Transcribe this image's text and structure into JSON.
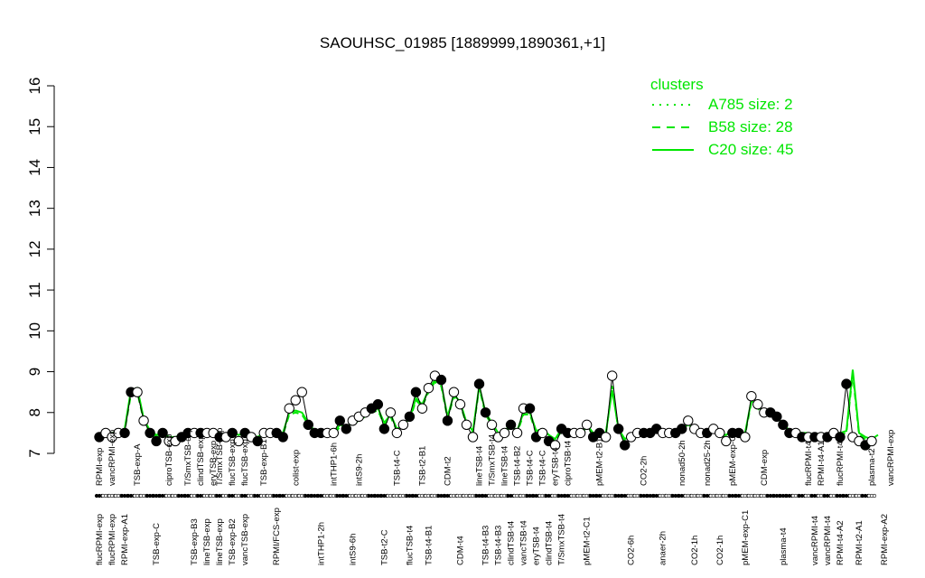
{
  "chart_data": {
    "type": "line",
    "title": "SAOUHSC_01985 [1889999,1890361,+1]",
    "ylim": [
      7,
      16
    ],
    "yticks": [
      7,
      8,
      9,
      10,
      11,
      12,
      13,
      14,
      15,
      16
    ],
    "legend": {
      "title": "clusters",
      "placement": "top-right",
      "entries": [
        {
          "label": "A785 size: 2",
          "style": "dotted"
        },
        {
          "label": "B58 size: 28",
          "style": "dashed"
        },
        {
          "label": "C20 size: 45",
          "style": "solid"
        }
      ]
    },
    "colors": {
      "cluster_line": "#00e600",
      "points_fill_a": "#000000",
      "points_fill_b": "#ffffff"
    },
    "tick_labels": [
      {
        "text": "flucRPMI-exp",
        "x": 1,
        "row": 0
      },
      {
        "text": "flucRPMI-exp",
        "x": 3,
        "row": 0
      },
      {
        "text": "RPMI-exp-A1",
        "x": 5,
        "row": 0
      },
      {
        "text": "TSB-exp-C",
        "x": 10,
        "row": 0
      },
      {
        "text": "TSB-exp-B3",
        "x": 16,
        "row": 0
      },
      {
        "text": "lineTSB-exp",
        "x": 18,
        "row": 0
      },
      {
        "text": "lineTSB-exp",
        "x": 20,
        "row": 0
      },
      {
        "text": "TSB-exp-B2",
        "x": 22,
        "row": 0
      },
      {
        "text": "vancTSB-exp",
        "x": 24,
        "row": 0
      },
      {
        "text": "RPMI/FCS-exp",
        "x": 29,
        "row": 0
      },
      {
        "text": "intTHP1-2h",
        "x": 36,
        "row": 0
      },
      {
        "text": "intS9-6h",
        "x": 41,
        "row": 0
      },
      {
        "text": "TSB-t2-C",
        "x": 46,
        "row": 0
      },
      {
        "text": "flucTSB-t4",
        "x": 50,
        "row": 0
      },
      {
        "text": "TSB-t4-B1",
        "x": 53,
        "row": 0
      },
      {
        "text": "CDM-t4",
        "x": 58,
        "row": 0
      },
      {
        "text": "TSB-t4-B3",
        "x": 62,
        "row": 0
      },
      {
        "text": "TSB-t4-B3",
        "x": 64,
        "row": 0
      },
      {
        "text": "clindTSB-t4",
        "x": 66,
        "row": 0
      },
      {
        "text": "vancTSB-t4",
        "x": 68,
        "row": 0
      },
      {
        "text": "eryTSB-t4",
        "x": 70,
        "row": 0
      },
      {
        "text": "clindTSB-t4",
        "x": 72,
        "row": 0
      },
      {
        "text": "T/SmxTSB-t4",
        "x": 74,
        "row": 0
      },
      {
        "text": "pMEM-t2-C1",
        "x": 78,
        "row": 0
      },
      {
        "text": "CO2-6h",
        "x": 85,
        "row": 0
      },
      {
        "text": "anaer-2h",
        "x": 90,
        "row": 0
      },
      {
        "text": "CO2-1h",
        "x": 95,
        "row": 0
      },
      {
        "text": "CO2-1h",
        "x": 99,
        "row": 0
      },
      {
        "text": "pMEM-exp-C1",
        "x": 103,
        "row": 0
      },
      {
        "text": "plasma-t4",
        "x": 109,
        "row": 0
      },
      {
        "text": "vancRPMI-t4",
        "x": 114,
        "row": 0
      },
      {
        "text": "vancRPMI-t4",
        "x": 116,
        "row": 0
      },
      {
        "text": "RPMI-t4-A2",
        "x": 118,
        "row": 0
      },
      {
        "text": "RPMI-t2-A1",
        "x": 121,
        "row": 0
      },
      {
        "text": "RPMI-exp-A2",
        "x": 125,
        "row": 0
      },
      {
        "text": "RPMI-exp",
        "x": 1,
        "row": 1
      },
      {
        "text": "vancRPMI-exp",
        "x": 3,
        "row": 1
      },
      {
        "text": "TSB-exp-A",
        "x": 7,
        "row": 1
      },
      {
        "text": "ciproTSB-exp",
        "x": 12,
        "row": 1
      },
      {
        "text": "T/SmxTSB-exp",
        "x": 15,
        "row": 1
      },
      {
        "text": "clindTSB-exp",
        "x": 17,
        "row": 1
      },
      {
        "text": "eryTSB-exp",
        "x": 19,
        "row": 1
      },
      {
        "text": "T/SmxTSB-exp",
        "x": 20,
        "row": 1
      },
      {
        "text": "flucTSB-exp",
        "x": 22,
        "row": 1
      },
      {
        "text": "flucTSB-exp",
        "x": 24,
        "row": 1
      },
      {
        "text": "TSB-exp-B1",
        "x": 27,
        "row": 1
      },
      {
        "text": "colist-exp",
        "x": 32,
        "row": 1
      },
      {
        "text": "intTHP1-6h",
        "x": 38,
        "row": 1
      },
      {
        "text": "intS9-2h",
        "x": 42,
        "row": 1
      },
      {
        "text": "TSB-t4-C",
        "x": 48,
        "row": 1
      },
      {
        "text": "TSB-t2-B1",
        "x": 52,
        "row": 1
      },
      {
        "text": "CDM-t2",
        "x": 56,
        "row": 1
      },
      {
        "text": "lineTSB-t4",
        "x": 61,
        "row": 1
      },
      {
        "text": "T/SmxTSB-t4",
        "x": 63,
        "row": 1
      },
      {
        "text": "lineTSB-t4",
        "x": 65,
        "row": 1
      },
      {
        "text": "TSB-t4-B2",
        "x": 67,
        "row": 1
      },
      {
        "text": "TSB-t4-C",
        "x": 69,
        "row": 1
      },
      {
        "text": "TSB-t4-C",
        "x": 71,
        "row": 1
      },
      {
        "text": "eryTSB-t4",
        "x": 73,
        "row": 1
      },
      {
        "text": "ciproTSB-t4",
        "x": 75,
        "row": 1
      },
      {
        "text": "pMEM-t2-B1",
        "x": 80,
        "row": 1
      },
      {
        "text": "CO2-2h",
        "x": 87,
        "row": 1
      },
      {
        "text": "nonad50-2h",
        "x": 93,
        "row": 1
      },
      {
        "text": "nonad25-2h",
        "x": 97,
        "row": 1
      },
      {
        "text": "pMEM-exp-C2",
        "x": 101,
        "row": 1
      },
      {
        "text": "CDM-exp",
        "x": 106,
        "row": 1
      },
      {
        "text": "flucRPMI-t4",
        "x": 113,
        "row": 1
      },
      {
        "text": "RPMI-t4-A1",
        "x": 115,
        "row": 1
      },
      {
        "text": "flucRPMI-t4",
        "x": 118,
        "row": 1
      },
      {
        "text": "plasma-t2",
        "x": 123,
        "row": 1
      },
      {
        "text": "vancRPMI-exp",
        "x": 126,
        "row": 1
      }
    ],
    "series": [
      {
        "x": 1,
        "y": 7.4,
        "filled": true
      },
      {
        "x": 2,
        "y": 7.5,
        "filled": false
      },
      {
        "x": 3,
        "y": 7.4,
        "filled": false
      },
      {
        "x": 4,
        "y": 7.5,
        "filled": false
      },
      {
        "x": 5,
        "y": 7.5,
        "filled": true
      },
      {
        "x": 6,
        "y": 8.5,
        "filled": true
      },
      {
        "x": 7,
        "y": 8.5,
        "filled": false
      },
      {
        "x": 8,
        "y": 7.8,
        "filled": false
      },
      {
        "x": 9,
        "y": 7.5,
        "filled": true
      },
      {
        "x": 10,
        "y": 7.3,
        "filled": true
      },
      {
        "x": 11,
        "y": 7.5,
        "filled": true
      },
      {
        "x": 12,
        "y": 7.3,
        "filled": false
      },
      {
        "x": 13,
        "y": 7.3,
        "filled": false
      },
      {
        "x": 14,
        "y": 7.4,
        "filled": true
      },
      {
        "x": 15,
        "y": 7.5,
        "filled": true
      },
      {
        "x": 16,
        "y": 7.5,
        "filled": false
      },
      {
        "x": 17,
        "y": 7.5,
        "filled": true
      },
      {
        "x": 18,
        "y": 7.5,
        "filled": false
      },
      {
        "x": 19,
        "y": 7.5,
        "filled": false
      },
      {
        "x": 20,
        "y": 7.4,
        "filled": true
      },
      {
        "x": 21,
        "y": 7.4,
        "filled": false
      },
      {
        "x": 22,
        "y": 7.5,
        "filled": true
      },
      {
        "x": 23,
        "y": 7.3,
        "filled": false
      },
      {
        "x": 24,
        "y": 7.5,
        "filled": true
      },
      {
        "x": 25,
        "y": 7.4,
        "filled": false
      },
      {
        "x": 26,
        "y": 7.3,
        "filled": true
      },
      {
        "x": 27,
        "y": 7.5,
        "filled": false
      },
      {
        "x": 28,
        "y": 7.5,
        "filled": false
      },
      {
        "x": 29,
        "y": 7.5,
        "filled": true
      },
      {
        "x": 30,
        "y": 7.4,
        "filled": true
      },
      {
        "x": 31,
        "y": 8.1,
        "filled": false
      },
      {
        "x": 32,
        "y": 8.3,
        "filled": false
      },
      {
        "x": 33,
        "y": 8.5,
        "filled": false
      },
      {
        "x": 34,
        "y": 7.7,
        "filled": true
      },
      {
        "x": 35,
        "y": 7.5,
        "filled": true
      },
      {
        "x": 36,
        "y": 7.5,
        "filled": true
      },
      {
        "x": 37,
        "y": 7.5,
        "filled": false
      },
      {
        "x": 38,
        "y": 7.5,
        "filled": false
      },
      {
        "x": 39,
        "y": 7.8,
        "filled": true
      },
      {
        "x": 40,
        "y": 7.6,
        "filled": true
      },
      {
        "x": 41,
        "y": 7.8,
        "filled": false
      },
      {
        "x": 42,
        "y": 7.9,
        "filled": false
      },
      {
        "x": 43,
        "y": 8.0,
        "filled": false
      },
      {
        "x": 44,
        "y": 8.1,
        "filled": true
      },
      {
        "x": 45,
        "y": 8.2,
        "filled": true
      },
      {
        "x": 46,
        "y": 7.6,
        "filled": true
      },
      {
        "x": 47,
        "y": 8.0,
        "filled": false
      },
      {
        "x": 48,
        "y": 7.5,
        "filled": false
      },
      {
        "x": 49,
        "y": 7.7,
        "filled": false
      },
      {
        "x": 50,
        "y": 7.9,
        "filled": true
      },
      {
        "x": 51,
        "y": 8.5,
        "filled": true
      },
      {
        "x": 52,
        "y": 8.1,
        "filled": false
      },
      {
        "x": 53,
        "y": 8.6,
        "filled": false
      },
      {
        "x": 54,
        "y": 8.9,
        "filled": false
      },
      {
        "x": 55,
        "y": 8.8,
        "filled": true
      },
      {
        "x": 56,
        "y": 7.8,
        "filled": true
      },
      {
        "x": 57,
        "y": 8.5,
        "filled": false
      },
      {
        "x": 58,
        "y": 8.2,
        "filled": false
      },
      {
        "x": 59,
        "y": 7.7,
        "filled": false
      },
      {
        "x": 60,
        "y": 7.4,
        "filled": false
      },
      {
        "x": 61,
        "y": 8.7,
        "filled": true
      },
      {
        "x": 62,
        "y": 8.0,
        "filled": true
      },
      {
        "x": 63,
        "y": 7.7,
        "filled": false
      },
      {
        "x": 64,
        "y": 7.4,
        "filled": false
      },
      {
        "x": 65,
        "y": 7.5,
        "filled": false
      },
      {
        "x": 66,
        "y": 7.7,
        "filled": true
      },
      {
        "x": 67,
        "y": 7.5,
        "filled": false
      },
      {
        "x": 68,
        "y": 8.1,
        "filled": false
      },
      {
        "x": 69,
        "y": 8.1,
        "filled": true
      },
      {
        "x": 70,
        "y": 7.4,
        "filled": true
      },
      {
        "x": 71,
        "y": 7.5,
        "filled": false
      },
      {
        "x": 72,
        "y": 7.3,
        "filled": true
      },
      {
        "x": 73,
        "y": 7.2,
        "filled": false
      },
      {
        "x": 74,
        "y": 7.6,
        "filled": true
      },
      {
        "x": 75,
        "y": 7.5,
        "filled": true
      },
      {
        "x": 76,
        "y": 7.5,
        "filled": false
      },
      {
        "x": 77,
        "y": 7.5,
        "filled": false
      },
      {
        "x": 78,
        "y": 7.7,
        "filled": false
      },
      {
        "x": 79,
        "y": 7.4,
        "filled": true
      },
      {
        "x": 80,
        "y": 7.5,
        "filled": true
      },
      {
        "x": 81,
        "y": 7.4,
        "filled": false
      },
      {
        "x": 82,
        "y": 8.9,
        "filled": false
      },
      {
        "x": 83,
        "y": 7.6,
        "filled": true
      },
      {
        "x": 84,
        "y": 7.2,
        "filled": true
      },
      {
        "x": 85,
        "y": 7.4,
        "filled": false
      },
      {
        "x": 86,
        "y": 7.5,
        "filled": false
      },
      {
        "x": 87,
        "y": 7.5,
        "filled": true
      },
      {
        "x": 88,
        "y": 7.5,
        "filled": true
      },
      {
        "x": 89,
        "y": 7.6,
        "filled": true
      },
      {
        "x": 90,
        "y": 7.5,
        "filled": false
      },
      {
        "x": 91,
        "y": 7.5,
        "filled": false
      },
      {
        "x": 92,
        "y": 7.5,
        "filled": true
      },
      {
        "x": 93,
        "y": 7.6,
        "filled": true
      },
      {
        "x": 94,
        "y": 7.8,
        "filled": false
      },
      {
        "x": 95,
        "y": 7.6,
        "filled": false
      },
      {
        "x": 96,
        "y": 7.5,
        "filled": false
      },
      {
        "x": 97,
        "y": 7.5,
        "filled": true
      },
      {
        "x": 98,
        "y": 7.6,
        "filled": false
      },
      {
        "x": 99,
        "y": 7.5,
        "filled": false
      },
      {
        "x": 100,
        "y": 7.3,
        "filled": false
      },
      {
        "x": 101,
        "y": 7.5,
        "filled": true
      },
      {
        "x": 102,
        "y": 7.5,
        "filled": true
      },
      {
        "x": 103,
        "y": 7.4,
        "filled": false
      },
      {
        "x": 104,
        "y": 8.4,
        "filled": false
      },
      {
        "x": 105,
        "y": 8.2,
        "filled": false
      },
      {
        "x": 106,
        "y": 8.0,
        "filled": false
      },
      {
        "x": 107,
        "y": 8.0,
        "filled": true
      },
      {
        "x": 108,
        "y": 7.9,
        "filled": true
      },
      {
        "x": 109,
        "y": 7.7,
        "filled": true
      },
      {
        "x": 110,
        "y": 7.5,
        "filled": true
      },
      {
        "x": 111,
        "y": 7.5,
        "filled": false
      },
      {
        "x": 112,
        "y": 7.4,
        "filled": true
      },
      {
        "x": 113,
        "y": 7.4,
        "filled": false
      },
      {
        "x": 114,
        "y": 7.4,
        "filled": true
      },
      {
        "x": 115,
        "y": 7.4,
        "filled": false
      },
      {
        "x": 116,
        "y": 7.4,
        "filled": true
      },
      {
        "x": 117,
        "y": 7.5,
        "filled": false
      },
      {
        "x": 118,
        "y": 7.4,
        "filled": true
      },
      {
        "x": 119,
        "y": 8.7,
        "filled": true
      },
      {
        "x": 120,
        "y": 7.4,
        "filled": false
      },
      {
        "x": 121,
        "y": 7.3,
        "filled": false
      },
      {
        "x": 122,
        "y": 7.2,
        "filled": true
      },
      {
        "x": 123,
        "y": 7.3,
        "filled": false
      }
    ],
    "cluster_lines": {
      "C20": [
        7.45,
        7.5,
        7.5,
        7.55,
        7.6,
        8.55,
        8.6,
        7.85,
        7.55,
        7.45,
        7.5,
        7.4,
        7.4,
        7.45,
        7.5,
        7.55,
        7.55,
        7.55,
        7.55,
        7.5,
        7.45,
        7.5,
        7.45,
        7.5,
        7.45,
        7.4,
        7.5,
        7.55,
        7.55,
        7.5,
        8.0,
        8.05,
        8.0,
        7.75,
        7.55,
        7.5,
        7.5,
        7.5,
        7.7,
        7.65,
        7.75,
        7.85,
        7.95,
        8.05,
        8.1,
        7.75,
        7.95,
        7.6,
        7.7,
        7.85,
        8.35,
        8.2,
        8.55,
        8.8,
        8.7,
        7.9,
        8.45,
        8.25,
        7.75,
        7.55,
        8.65,
        8.0,
        7.75,
        7.5,
        7.55,
        7.7,
        7.55,
        8.0,
        8.0,
        7.55,
        7.6,
        7.45,
        7.35,
        7.6,
        7.55,
        7.55,
        7.5,
        7.7,
        7.5,
        7.55,
        7.5,
        8.55,
        7.6,
        7.35,
        7.45,
        7.5,
        7.55,
        7.55,
        7.6,
        7.55,
        7.5,
        7.55,
        7.6,
        7.7,
        7.6,
        7.55,
        7.55,
        7.6,
        7.5,
        7.45,
        7.55,
        7.55,
        7.5,
        8.3,
        8.15,
        8.0,
        8.0,
        7.85,
        7.75,
        7.55,
        7.55,
        7.5,
        7.5,
        7.45,
        7.5,
        7.45,
        7.5,
        7.5,
        7.55,
        9.05,
        7.5,
        7.4,
        7.35,
        7.45
      ],
      "B58": [
        7.4,
        7.45,
        7.4,
        7.5,
        7.55,
        8.45,
        8.5,
        7.8,
        7.5,
        7.4,
        7.45,
        7.35,
        7.35,
        7.4,
        7.45,
        7.5,
        7.5,
        7.5,
        7.5,
        7.45,
        7.4,
        7.45,
        7.35,
        7.45,
        7.4,
        7.35,
        7.45,
        7.5,
        7.5,
        7.45,
        7.95,
        8.0,
        7.95,
        7.7,
        7.5,
        7.45,
        7.45,
        7.45,
        7.65,
        7.6,
        7.7,
        7.8,
        7.9,
        8.0,
        8.05,
        7.7,
        7.9,
        7.55,
        7.65,
        7.8,
        8.3,
        8.15,
        8.5,
        8.75,
        8.65,
        7.85,
        8.4,
        8.2,
        7.7,
        7.5,
        8.6,
        7.95,
        7.7,
        7.45,
        7.5,
        7.65,
        7.5,
        7.95,
        7.95,
        7.5,
        7.55,
        7.4,
        7.3,
        7.55,
        7.5,
        7.5,
        7.45,
        7.65,
        7.45,
        7.5,
        7.45,
        8.65,
        7.55,
        7.3,
        7.4,
        7.45,
        7.5,
        7.5,
        7.55,
        7.5,
        7.45,
        7.5,
        7.55,
        7.65,
        7.55,
        7.5,
        7.5,
        7.55,
        7.45,
        7.4,
        7.5,
        7.5,
        7.45,
        8.25,
        8.1,
        7.95,
        7.95,
        7.8,
        7.7,
        7.5,
        7.5,
        7.45,
        7.45,
        7.4,
        7.45,
        7.4,
        7.45,
        7.45,
        7.5,
        8.95,
        7.45,
        7.35,
        7.3,
        7.4
      ]
    }
  }
}
